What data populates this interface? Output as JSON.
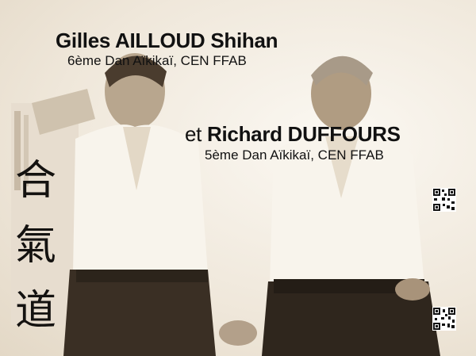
{
  "header": {
    "name1": "Gilles AILLOUD Shihan",
    "grade1": "6ème Dan Aïkikaï, CEN FFAB",
    "conj": "et",
    "name2": "Richard DUFFOURS",
    "grade2": "5ème Dan Aïkikaï, CEN FFAB"
  },
  "calligraphy": [
    "合",
    "氣",
    "道"
  ],
  "colors": {
    "sepia_dark": "#3a2f24",
    "sepia_mid": "#8a7a66",
    "paper": "#f4efe6"
  },
  "icons": [
    "qr-code-icon",
    "qr-code-icon"
  ]
}
